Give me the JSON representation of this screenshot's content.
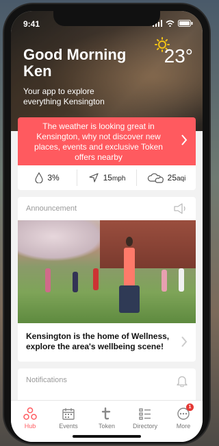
{
  "status_bar": {
    "time": "9:41"
  },
  "hero": {
    "greeting": "Good Morning Ken",
    "subtitle": "Your app to explore everything Kensington",
    "temperature": "23°",
    "weather_icon": "sun-icon"
  },
  "banner": {
    "text": "The weather is looking great in Kensington, why not discover new places, events and exclusive Token offers nearby"
  },
  "stats": [
    {
      "icon": "raindrop-icon",
      "value": "3%",
      "unit": ""
    },
    {
      "icon": "wind-direction-icon",
      "value": "15",
      "unit": "mph"
    },
    {
      "icon": "clouds-icon",
      "value": "25",
      "unit": "aqi"
    }
  ],
  "announcement": {
    "title": "Announcement",
    "text": "Kensington is the home of Wellness, explore the area's wellbeing scene!"
  },
  "notifications": {
    "title": "Notifications"
  },
  "tabbar": {
    "tabs": [
      {
        "label": "Hub",
        "icon": "hub-icon",
        "active": true
      },
      {
        "label": "Events",
        "icon": "calendar-icon"
      },
      {
        "label": "Token",
        "icon": "token-icon"
      },
      {
        "label": "Directory",
        "icon": "directory-list-icon"
      },
      {
        "label": "More",
        "icon": "more-icon",
        "badge": "1"
      }
    ]
  },
  "colors": {
    "accent": "#ff5a5f",
    "badge": "#e53935"
  }
}
